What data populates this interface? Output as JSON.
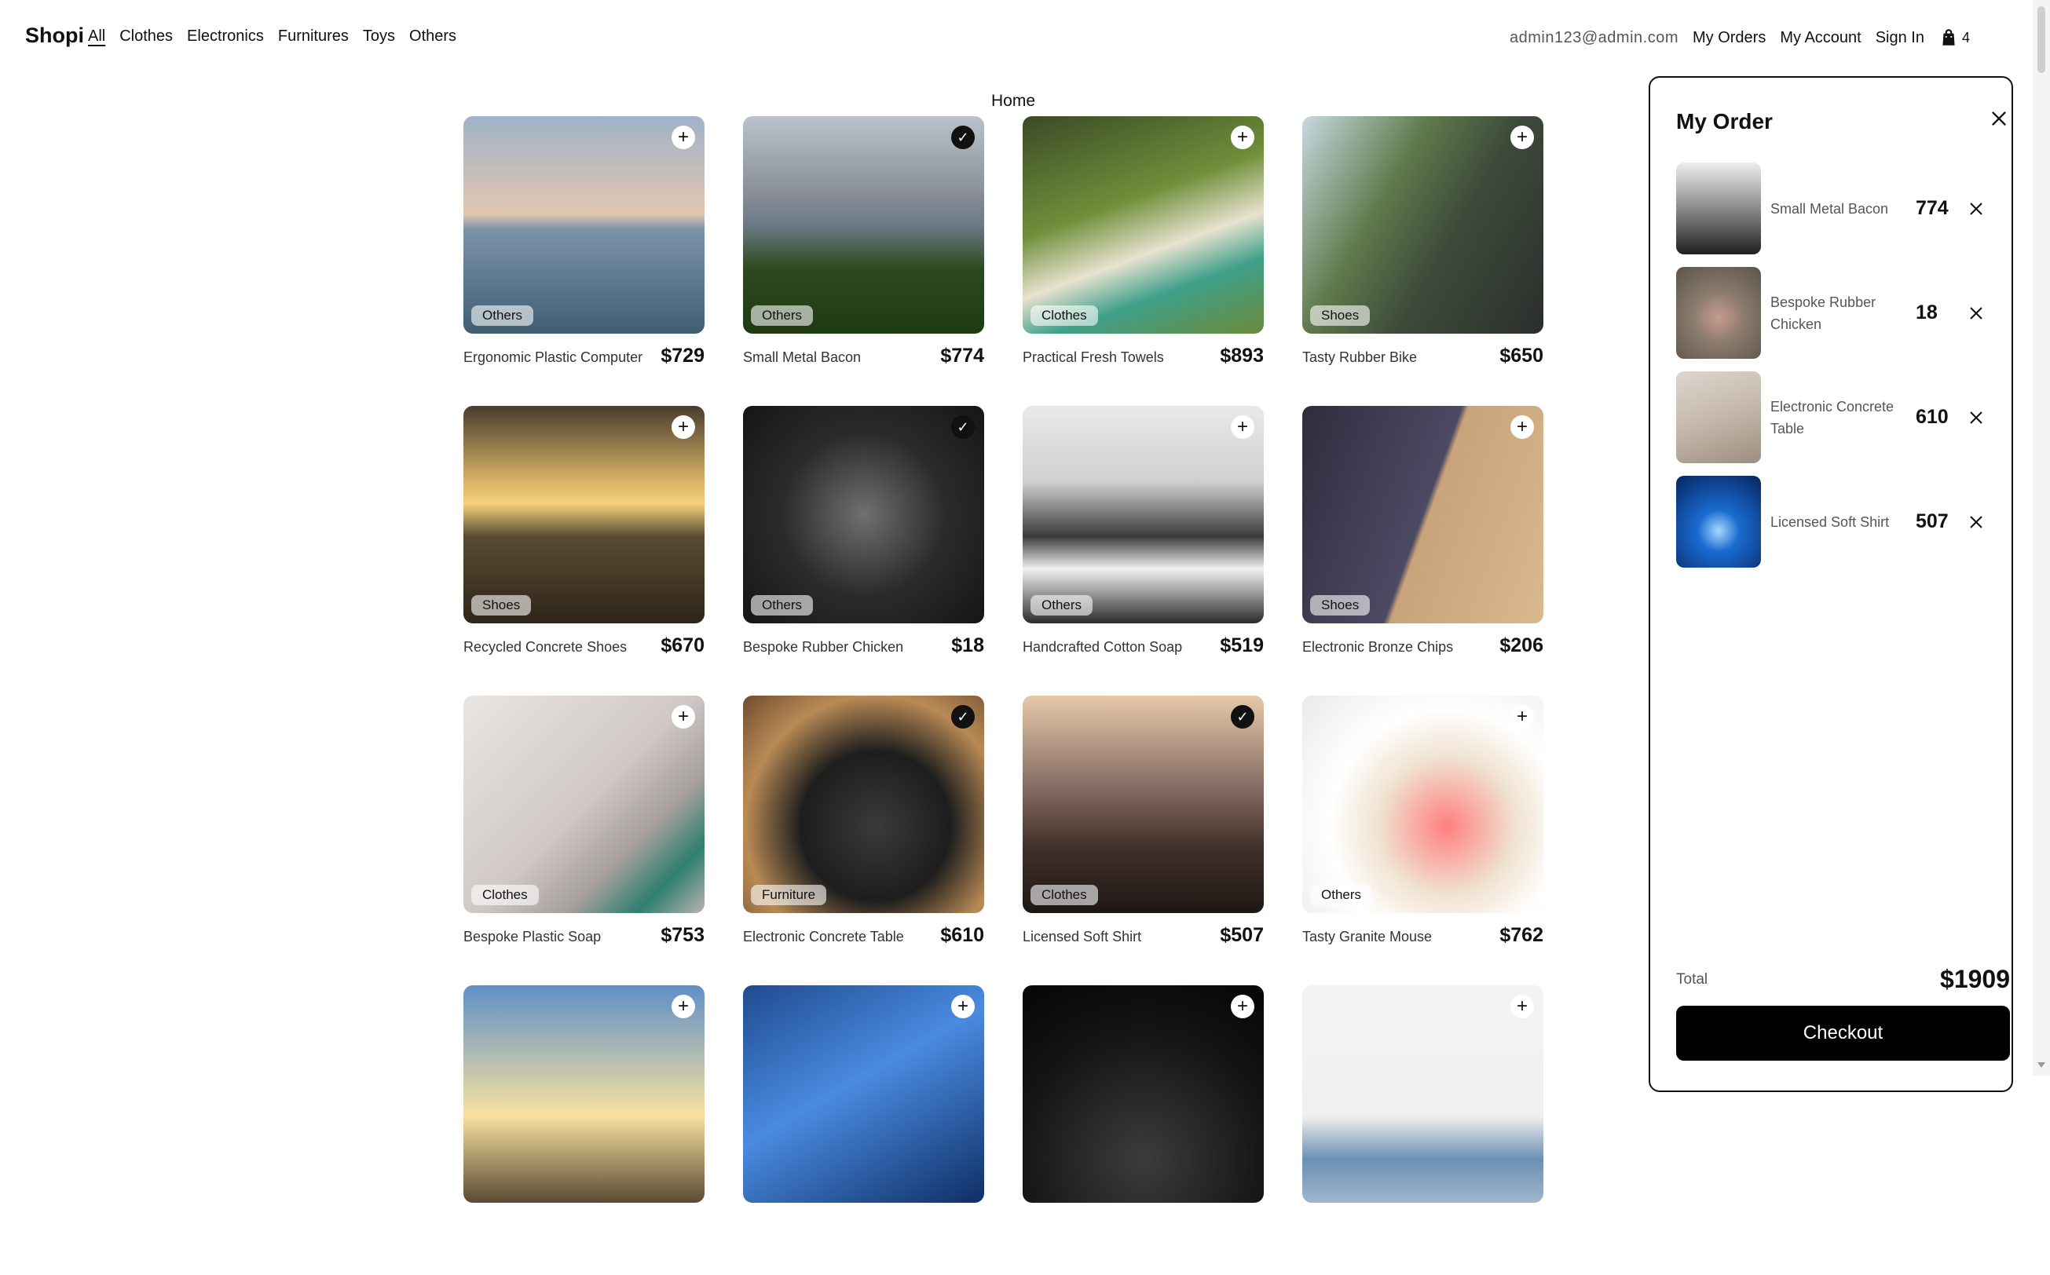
{
  "nav": {
    "brand": "Shopi",
    "categories": [
      "All",
      "Clothes",
      "Electronics",
      "Furnitures",
      "Toys",
      "Others"
    ],
    "active": "All",
    "email": "admin123@admin.com",
    "my_orders": "My Orders",
    "my_account": "My Account",
    "sign_in": "Sign In",
    "cart_count": "4"
  },
  "home_title": "Home",
  "products": [
    {
      "name": "Ergonomic Plastic Computer",
      "price": "$729",
      "category": "Others",
      "added": false
    },
    {
      "name": "Small Metal Bacon",
      "price": "$774",
      "category": "Others",
      "added": true
    },
    {
      "name": "Practical Fresh Towels",
      "price": "$893",
      "category": "Clothes",
      "added": false
    },
    {
      "name": "Tasty Rubber Bike",
      "price": "$650",
      "category": "Shoes",
      "added": false
    },
    {
      "name": "Recycled Concrete Shoes",
      "price": "$670",
      "category": "Shoes",
      "added": false
    },
    {
      "name": "Bespoke Rubber Chicken",
      "price": "$18",
      "category": "Others",
      "added": true
    },
    {
      "name": "Handcrafted Cotton Soap",
      "price": "$519",
      "category": "Others",
      "added": false
    },
    {
      "name": "Electronic Bronze Chips",
      "price": "$206",
      "category": "Shoes",
      "added": false
    },
    {
      "name": "Bespoke Plastic Soap",
      "price": "$753",
      "category": "Clothes",
      "added": false
    },
    {
      "name": "Electronic Concrete Table",
      "price": "$610",
      "category": "Furniture",
      "added": true
    },
    {
      "name": "Licensed Soft Shirt",
      "price": "$507",
      "category": "Clothes",
      "added": true
    },
    {
      "name": "Tasty Granite Mouse",
      "price": "$762",
      "category": "Others",
      "added": false
    },
    {
      "name": "",
      "price": "",
      "category": "",
      "added": false
    },
    {
      "name": "",
      "price": "",
      "category": "",
      "added": false
    },
    {
      "name": "",
      "price": "",
      "category": "",
      "added": false
    },
    {
      "name": "",
      "price": "",
      "category": "",
      "added": false
    }
  ],
  "order_panel": {
    "title": "My Order",
    "items": [
      {
        "name": "Small Metal Bacon",
        "price": "774"
      },
      {
        "name": "Bespoke Rubber Chicken",
        "price": "18"
      },
      {
        "name": "Electronic Concrete Table",
        "price": "610"
      },
      {
        "name": "Licensed Soft Shirt",
        "price": "507"
      }
    ],
    "total_label": "Total",
    "total_value": "$1909",
    "checkout_label": "Checkout"
  },
  "icons": {
    "add": "plus-icon",
    "added": "check-icon",
    "close": "close-icon",
    "cart": "shopping-bag-icon"
  }
}
